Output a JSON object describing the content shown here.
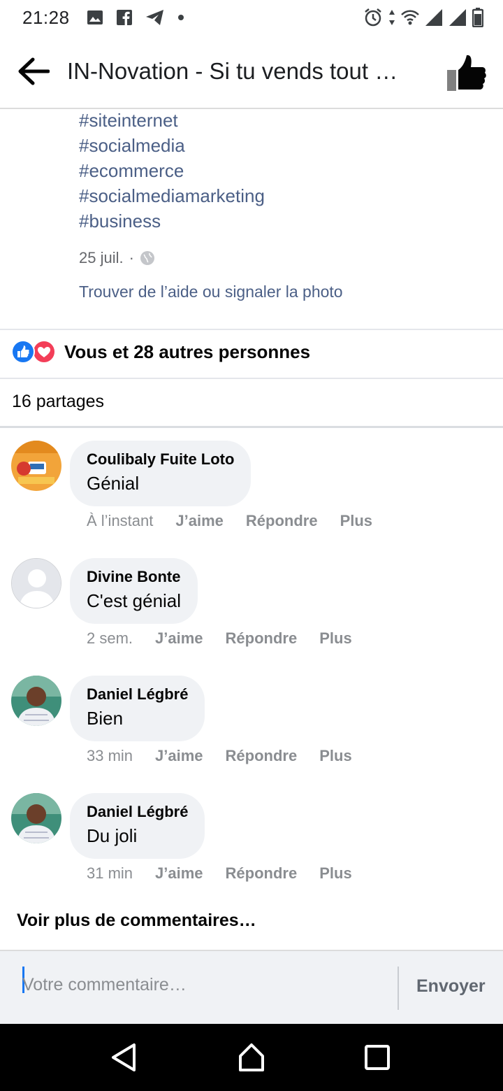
{
  "status_bar": {
    "time": "21:28",
    "left_icons": [
      "image-icon",
      "facebook-icon",
      "telegram-icon",
      "dot-icon"
    ],
    "right_icons": [
      "alarm-icon",
      "wifi-icon",
      "signal-icon",
      "signal-icon",
      "battery-icon"
    ]
  },
  "header": {
    "title": "IN-Novation - Si tu vends tout …"
  },
  "post": {
    "hashtags": [
      "#siteinternet",
      "#socialmedia",
      "#ecommerce",
      "#socialmediamarketing",
      "#business"
    ],
    "date": "25 juil.",
    "date_separator": "·",
    "help_link": "Trouver de l’aide ou signaler la photo"
  },
  "reactions": {
    "text": "Vous et 28 autres personnes",
    "shares": "16 partages"
  },
  "comments": [
    {
      "author": "Coulibaly Fuite Loto",
      "text": "Génial",
      "time": "À l’instant"
    },
    {
      "author": "Divine Bonte",
      "text": "C'est génial",
      "time": "2 sem."
    },
    {
      "author": "Daniel Légbré",
      "text": "Bien",
      "time": "33 min"
    },
    {
      "author": "Daniel Légbré",
      "text": "Du joli",
      "time": "31 min"
    }
  ],
  "comment_actions": {
    "like": "J’aime",
    "reply": "Répondre",
    "more": "Plus"
  },
  "more_comments": "Voir plus de commentaires…",
  "composer": {
    "placeholder": "Votre commentaire…",
    "send": "Envoyer"
  },
  "colors": {
    "link": "#4b5f86",
    "like_blue": "#1877f2",
    "love_red": "#f33e58",
    "bubble": "#f0f2f5"
  }
}
